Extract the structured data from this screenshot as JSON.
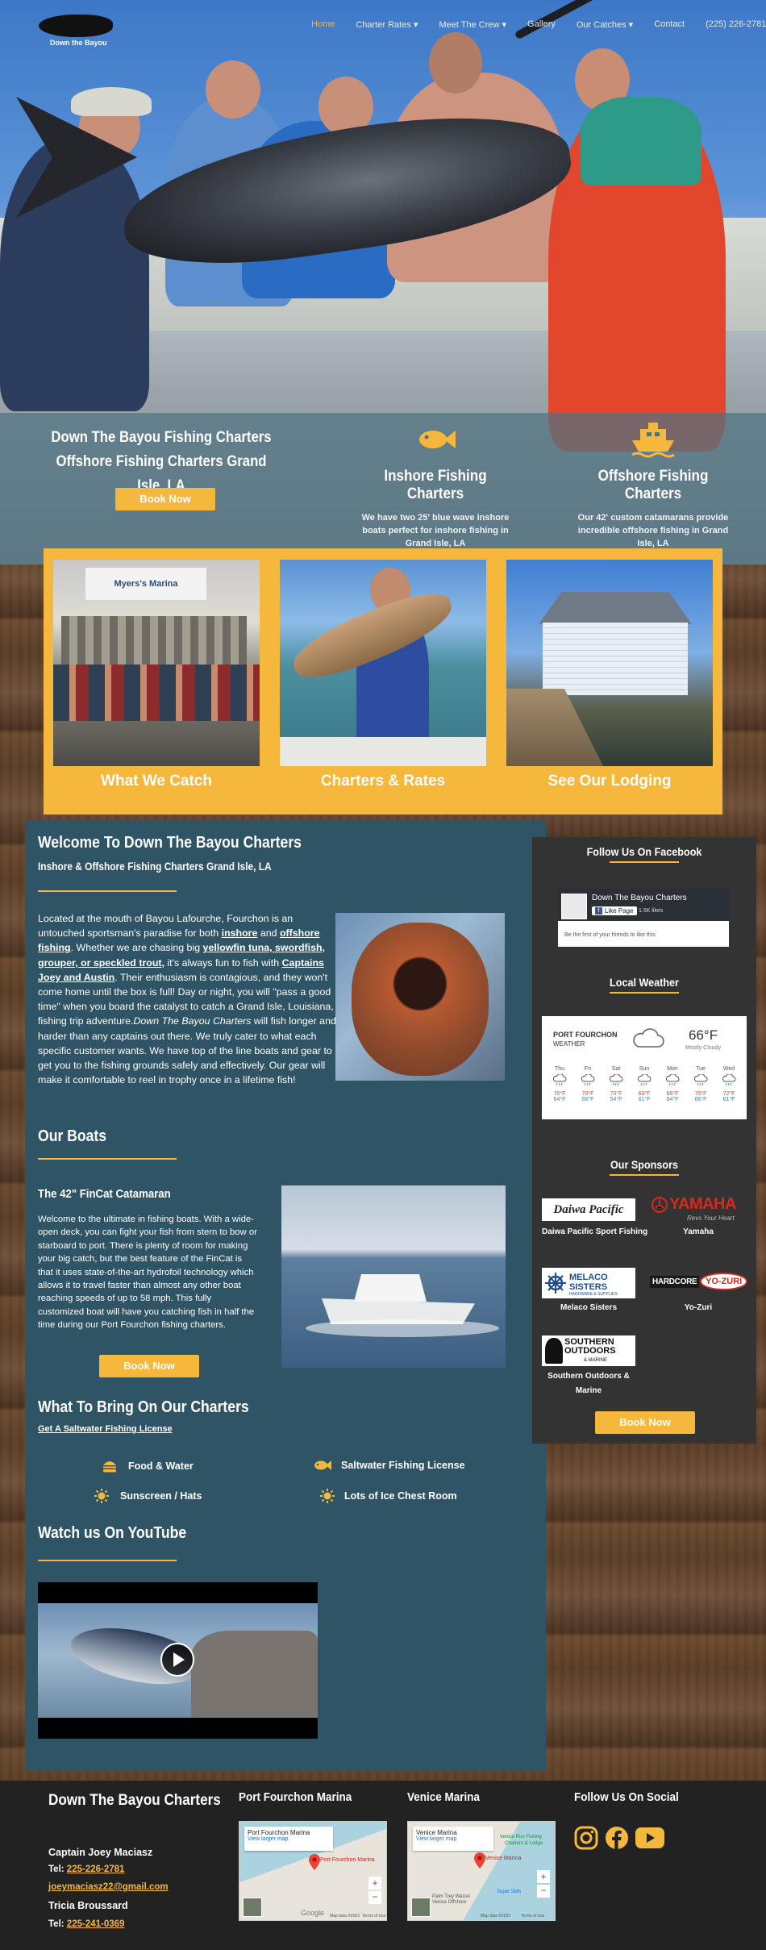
{
  "nav": {
    "logo_text": "Down the Bayou",
    "items": [
      "Home",
      "Charter Rates",
      "Meet The Crew",
      "Gallery",
      "Our Catches",
      "Contact"
    ],
    "dropdown_flags": [
      false,
      true,
      true,
      false,
      true,
      false
    ],
    "phone": "(225) 226-2781"
  },
  "hero": {
    "title_line1": "Down The Bayou Fishing Charters",
    "title_line2": "Offshore Fishing Charters Grand Isle, LA",
    "book_now": "Book Now",
    "features": [
      {
        "icon": "fish-icon",
        "title": "Inshore Fishing Charters",
        "text": "We have two 25' blue wave inshore boats perfect for inshore fishing in Grand Isle, LA"
      },
      {
        "icon": "ship-icon",
        "title": "Offshore Fishing Charters",
        "text": "Our 42' custom catamarans provide incredible offshore fishing in Grand Isle, LA"
      }
    ]
  },
  "gallery": {
    "cards": [
      "What We Catch",
      "Charters & Rates",
      "See Our Lodging"
    ],
    "sign_text": "Myers's Marina"
  },
  "welcome": {
    "title": "Welcome To Down The Bayou Charters",
    "subtitle": "Inshore & Offshore Fishing Charters Grand Isle, LA",
    "p1": "Located at the mouth of Bayou Lafourche, Fourchon is an untouched sportsman's paradise for both",
    "link_inshore": "inshore",
    "and": " and ",
    "link_offshore": "offshore fishing",
    "p2": ".  Whether we are chasing big",
    "link_species": "yellowfin tuna, swordfish, grouper, or speckled trout,",
    "p3": " it's always fun to fish with",
    "link_captains": "Captains Joey and Austin",
    "p4": ". Their enthusiasm is contagious, and they won't come home until the box is full! Day or night, you will \"pass a good time\" when you board the catalyst to catch a Grand Isle, Louisiana, fishing trip adventure.",
    "italic": "Down The Bayou Charters",
    "p5": " will fish longer and harder than any captains out there. We truly cater to what each specific customer wants. We have top of the line boats and gear to get you to the fishing grounds safely and effectively. Our gear will make it comfortable to reel in trophy once in a lifetime fish!"
  },
  "boats": {
    "title": "Our Boats",
    "boat_title": "The 42\" FinCat Catamaran",
    "boat_text": "Welcome to the ultimate in fishing boats. With a wide-open deck, you can fight your fish from stern to bow or starboard to port. There is plenty of room for making your big catch, but the best feature of the FinCat is that it uses state-of-the-art hydrofoil technology which allows it to travel faster than almost any other boat reaching speeds of up to 58 mph. This fully customized boat will have you catching fish in half the time during our Port Fourchon fishing charters.",
    "book_now": "Book Now"
  },
  "bring": {
    "title": "What To Bring On Our Charters",
    "link": "Get A Saltwater Fishing License",
    "items": [
      {
        "icon": "burger-icon",
        "label": "Food & Water"
      },
      {
        "icon": "fish-icon",
        "label": "Saltwater Fishing License"
      },
      {
        "icon": "sun-icon",
        "label": "Sunscreen / Hats"
      },
      {
        "icon": "sun-icon",
        "label": "Lots of Ice Chest Room"
      }
    ]
  },
  "youtube": {
    "title": "Watch us On YouTube"
  },
  "sidebar": {
    "facebook_title": "Follow Us On Facebook",
    "fb_page_name": "Down The Bayou Charters",
    "fb_like": "Like Page",
    "fb_likes": "1.5K likes",
    "fb_first": "Be the first of your friends to like this",
    "weather_title": "Local Weather",
    "weather_place": "PORT FOURCHON",
    "weather_sub": "WEATHER",
    "weather_temp": "66°F",
    "weather_desc": "Mostly Cloudy",
    "days": [
      {
        "d": "Thu",
        "hi": "70°F",
        "lo": "64°F"
      },
      {
        "d": "Fri",
        "hi": "70°F",
        "lo": "66°F"
      },
      {
        "d": "Sat",
        "hi": "70°F",
        "lo": "54°F"
      },
      {
        "d": "Sun",
        "hi": "63°F",
        "lo": "61°F"
      },
      {
        "d": "Mon",
        "hi": "66°F",
        "lo": "64°F"
      },
      {
        "d": "Tue",
        "hi": "70°F",
        "lo": "66°F"
      },
      {
        "d": "Wed",
        "hi": "72°F",
        "lo": "61°F"
      }
    ],
    "sponsors_title": "Our Sponsors",
    "sponsors": [
      {
        "logo": "Daiwa Pacific",
        "name": "Daiwa Pacific Sport Fishing"
      },
      {
        "logo": "YAMAHA",
        "tag": "Revs Your Heart",
        "name": "Yamaha"
      },
      {
        "logo": "MELACO SISTERS",
        "sub": "HARDWARE & SUPPLIES",
        "name": "Melaco Sisters"
      },
      {
        "logo": "HARDCORE",
        "logo2": "YO-ZURI",
        "name": "Yo-Zuri"
      },
      {
        "logo": "SOUTHERN OUTDOORS",
        "sub": "& MARINE",
        "name": "Southern Outdoors & Marine"
      }
    ],
    "book_now": "Book Now"
  },
  "footer": {
    "brand": "Down The Bayou Charters",
    "captain": "Captain Joey Maciasz",
    "tel_label": "Tel: ",
    "tel1": "225-226-2781",
    "email": "joeymaciasz22@gmail.com",
    "name2": "Tricia Broussard",
    "tel2": "225-241-0369",
    "marina1": "Port Fourchon Marina",
    "marina1_map": "Port Fourchon Marina",
    "marina2": "Venice Marina",
    "marina2_map": "Venice Marina",
    "view_larger": "View larger map",
    "social_title": "Follow Us On Social",
    "map_credit": "Google",
    "map_data": "Map data ©2023",
    "map_terms": "Terms of Use",
    "venice_labels": [
      "Venice Run Fishing",
      "Charters & Lodge",
      "Super Stills",
      "Palm Trey Watzel",
      "Venice Offshore"
    ]
  },
  "colors": {
    "accent": "#f6b83c",
    "panel": "#2e5466",
    "sidebar": "#333333",
    "footer": "#222222",
    "nav_text": "#e6ebf3"
  }
}
